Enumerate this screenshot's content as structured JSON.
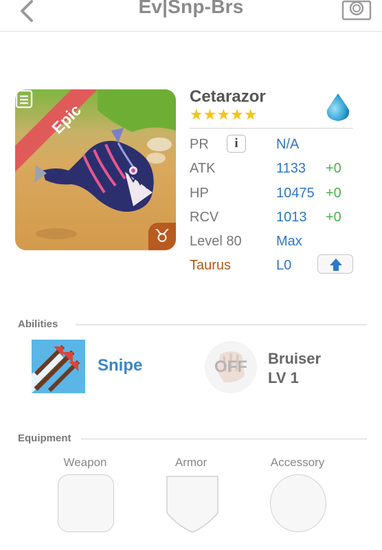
{
  "header": {
    "title": "Ev|Snp-Brs",
    "back_icon": "chevron-left-icon",
    "camera_icon": "camera-icon"
  },
  "monster": {
    "name": "Cetarazor",
    "stars": "★★★★★",
    "rarity": "Epic",
    "element_icon": "water-drop-icon",
    "sign_icon": "taurus-icon",
    "sign_glyph": "♉"
  },
  "stats": {
    "pr": {
      "label": "PR",
      "value": "N/A"
    },
    "atk": {
      "label": "ATK",
      "value": "1133",
      "plus": "+0"
    },
    "hp": {
      "label": "HP",
      "value": "10475",
      "plus": "+0"
    },
    "rcv": {
      "label": "RCV",
      "value": "1013",
      "plus": "+0"
    },
    "level": {
      "label": "Level 80",
      "value": "Max"
    },
    "sign": {
      "label": "Taurus",
      "value": "L0"
    }
  },
  "abilities": {
    "title": "Abilities",
    "active": {
      "name": "Snipe",
      "icon": "snipe-arrows-icon"
    },
    "leader": {
      "status": "OFF",
      "name": "Bruiser",
      "level": "LV 1",
      "icon": "fist-icon"
    }
  },
  "equipment": {
    "title": "Equipment",
    "slots": [
      "Weapon",
      "Armor",
      "Accessory"
    ]
  },
  "colors": {
    "accent_blue": "#2f77c3",
    "plus_green": "#4caf50",
    "epic_red": "#e05a5a",
    "sign_orange": "#b35a12"
  }
}
